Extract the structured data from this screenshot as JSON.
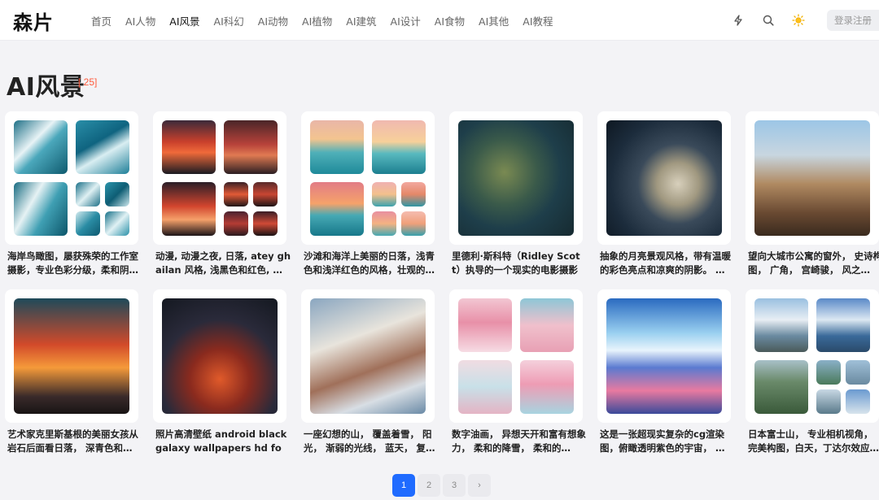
{
  "header": {
    "logo": "森片",
    "nav": [
      "首页",
      "AI人物",
      "AI风景",
      "AI科幻",
      "AI动物",
      "AI植物",
      "AI建筑",
      "AI设计",
      "AI食物",
      "AI其他",
      "AI教程"
    ],
    "active_nav": "AI风景",
    "icons": [
      "lightning-icon",
      "search-icon",
      "sun-icon"
    ],
    "login_label": "登录注册"
  },
  "page": {
    "title": "AI风景",
    "count": "[ 25]"
  },
  "cards": [
    {
      "caption": "海岸鸟瞰图，屡获殊荣的工作室摄影，专业色彩分级，柔和阴…"
    },
    {
      "caption": "动漫, 动漫之夜, 日落, atey ghailan 风格, 浅黑色和红色, …"
    },
    {
      "caption": "沙滩和海洋上美丽的日落，浅青色和浅洋红色的风格，壮观的…"
    },
    {
      "caption": "里德利·斯科特（Ridley Scott）执导的一个现实的电影摄影场…"
    },
    {
      "caption": "抽象的月亮景观风格，带有温暖的彩色亮点和凉爽的阴影。 …"
    },
    {
      "caption": "望向大城市公寓的窗外， 史诗构图， 广角， 宫崎骏， 风之…"
    },
    {
      "caption": "艺术家克里斯基根的美丽女孩从岩石后面看日落， 深青色和…"
    },
    {
      "caption": "照片高清壁纸 android black galaxy wallpapers hd for…"
    },
    {
      "caption": "一座幻想的山， 覆盖着雪， 阳光， 渐弱的光线， 蓝天， 复…"
    },
    {
      "caption": "数字油画， 异想天开和富有想象力， 柔和的降雪， 柔和的…"
    },
    {
      "caption": "这是一张超现实复杂的cg渲染图，俯瞰透明紫色的宇宙， …"
    },
    {
      "caption": "日本富士山， 专业相机视角， 完美构图，白天，丁达尔效应…"
    }
  ],
  "pagination": {
    "pages": [
      "1",
      "2",
      "3"
    ],
    "current": "1",
    "next": "›"
  }
}
